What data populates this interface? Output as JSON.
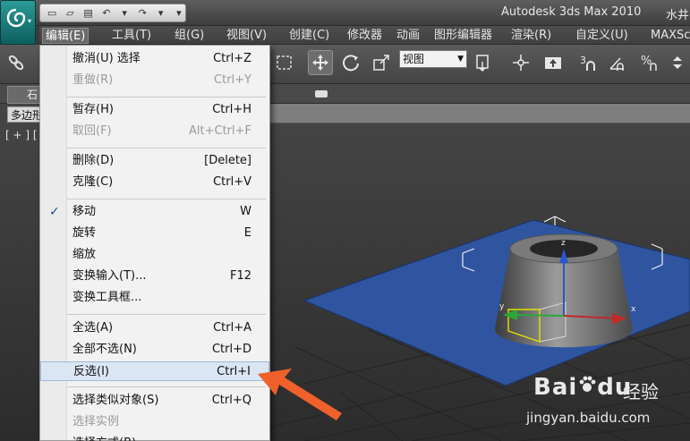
{
  "app": {
    "title": "Autodesk 3ds Max  2010",
    "file_title": "水井",
    "logo_arrow": "▾"
  },
  "quick_access": {
    "icons": [
      "new-file-icon",
      "open-folder-icon",
      "save-icon",
      "undo-icon",
      "dropdown-arrow-icon",
      "redo-icon",
      "dropdown-arrow-icon",
      "customize-icon"
    ],
    "glyphs": [
      "▭",
      "▱",
      "▤",
      "↶",
      "▾",
      "↷",
      "▾",
      "▾"
    ]
  },
  "menubar": {
    "items": [
      {
        "label": "编辑(E)"
      },
      {
        "label": "工具(T)"
      },
      {
        "label": "组(G)"
      },
      {
        "label": "视图(V)"
      },
      {
        "label": "创建(C)"
      },
      {
        "label": "修改器"
      },
      {
        "label": "动画"
      },
      {
        "label": "图形编辑器"
      },
      {
        "label": "渲染(R)"
      },
      {
        "label": "自定义(U)"
      },
      {
        "label": "MAXScript"
      }
    ]
  },
  "toolbar": {
    "view_dropdown": "视图",
    "dropdown_arrow": "▼"
  },
  "ribbon": {
    "tab_label": "石",
    "poly_label": "多边形"
  },
  "viewport": {
    "label": "[ + ] [",
    "gizmo_axes": [
      "x",
      "y",
      "z"
    ]
  },
  "edit_menu": {
    "items": [
      {
        "label": "撤消(U) 选择",
        "shortcut": "Ctrl+Z",
        "enabled": true,
        "checked": false,
        "highlighted": false
      },
      {
        "label": "重做(R)",
        "shortcut": "Ctrl+Y",
        "enabled": false,
        "checked": false,
        "highlighted": false
      },
      {
        "label": "暂存(H)",
        "shortcut": "Ctrl+H",
        "enabled": true,
        "checked": false,
        "highlighted": false
      },
      {
        "label": "取回(F)",
        "shortcut": "Alt+Ctrl+F",
        "enabled": false,
        "checked": false,
        "highlighted": false
      },
      {
        "label": "删除(D)",
        "shortcut": "[Delete]",
        "enabled": true,
        "checked": false,
        "highlighted": false
      },
      {
        "label": "克隆(C)",
        "shortcut": "Ctrl+V",
        "enabled": true,
        "checked": false,
        "highlighted": false
      },
      {
        "label": "移动",
        "shortcut": "W",
        "enabled": true,
        "checked": true,
        "highlighted": false
      },
      {
        "label": "旋转",
        "shortcut": "E",
        "enabled": true,
        "checked": false,
        "highlighted": false
      },
      {
        "label": "缩放",
        "shortcut": "",
        "enabled": true,
        "checked": false,
        "highlighted": false
      },
      {
        "label": "变换输入(T)...",
        "shortcut": "F12",
        "enabled": true,
        "checked": false,
        "highlighted": false
      },
      {
        "label": "变换工具框...",
        "shortcut": "",
        "enabled": true,
        "checked": false,
        "highlighted": false
      },
      {
        "label": "全选(A)",
        "shortcut": "Ctrl+A",
        "enabled": true,
        "checked": false,
        "highlighted": false
      },
      {
        "label": "全部不选(N)",
        "shortcut": "Ctrl+D",
        "enabled": true,
        "checked": false,
        "highlighted": false
      },
      {
        "label": "反选(I)",
        "shortcut": "Ctrl+I",
        "enabled": true,
        "checked": false,
        "highlighted": true
      },
      {
        "label": "选择类似对象(S)",
        "shortcut": "Ctrl+Q",
        "enabled": true,
        "checked": false,
        "highlighted": false
      },
      {
        "label": "选择实例",
        "shortcut": "",
        "enabled": false,
        "checked": false,
        "highlighted": false
      },
      {
        "label": "选择方式(B)",
        "shortcut": "",
        "enabled": true,
        "checked": false,
        "highlighted": false
      }
    ],
    "check_glyph": "✓"
  },
  "watermark": {
    "brand": "Bai",
    "brand_end": "du",
    "product": "经验",
    "url": "jingyan.baidu.com"
  },
  "colors": {
    "accent_arrow": "#f0602a",
    "plane_blue": "#2f55a0",
    "menu_highlight": "#dbe6f5",
    "viewport_bg": "#4a4a4a"
  }
}
